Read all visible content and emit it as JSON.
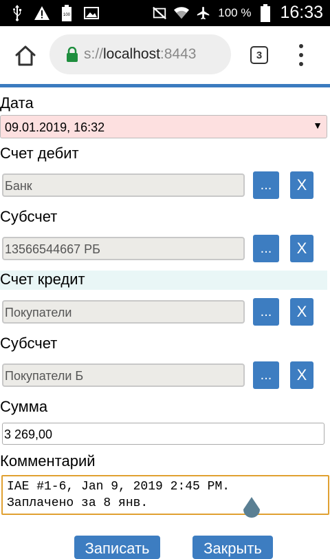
{
  "status_bar": {
    "battery_percent": "100 %",
    "time": "16:33",
    "icons": [
      "usb-icon",
      "warning-icon",
      "battery-full-icon",
      "image-icon",
      "mute-icon",
      "wifi-icon",
      "airplane-icon",
      "battery-icon"
    ]
  },
  "browser": {
    "url_prefix": "s://",
    "url_host": "localhost",
    "url_port": ":8443",
    "tab_count": "3"
  },
  "form": {
    "date": {
      "label": "Дата",
      "value": "09.01.2019, 16:32"
    },
    "debit_account": {
      "label": "Счет дебит",
      "value": "Банк",
      "pick_label": "...",
      "clear_label": "X"
    },
    "debit_subaccount": {
      "label": "Субсчет",
      "value": "13566544667 РБ",
      "pick_label": "...",
      "clear_label": "X"
    },
    "credit_account": {
      "label": "Счет кредит",
      "value": "Покупатели",
      "pick_label": "...",
      "clear_label": "X"
    },
    "credit_subaccount": {
      "label": "Субсчет",
      "value": "Покупатели Б",
      "pick_label": "...",
      "clear_label": "X"
    },
    "amount": {
      "label": "Сумма",
      "value": "3 269,00"
    },
    "comment": {
      "label": "Комментарий",
      "value": "IAE #1-6, Jan 9, 2019 2:45 PM.\nЗаплачено за 8 янв."
    },
    "save_label": "Записать",
    "close_label": "Закрыть"
  },
  "colors": {
    "accent": "#3b7bbf",
    "button": "#3d7dc1",
    "date_bg": "#fde0e0",
    "highlight_row": "#e9f6f6",
    "comment_border": "#e0a030"
  }
}
